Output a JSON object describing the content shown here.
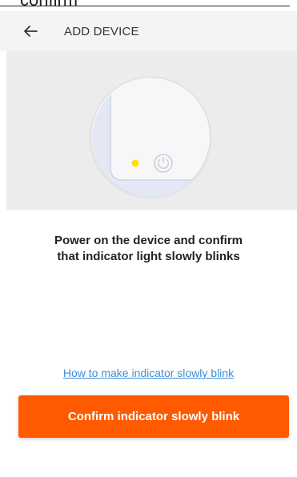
{
  "top_caption": "confirm",
  "header": {
    "title": "ADD DEVICE",
    "back_icon": "arrow-left-icon"
  },
  "illustration": {
    "indicator_color": "#ffe000",
    "icon": "power-icon"
  },
  "instruction": {
    "line1": "Power on the device and confirm",
    "line2": "that indicator light slowly blinks"
  },
  "help_link": "How to make indicator slowly blink",
  "confirm_button": "Confirm indicator slowly blink",
  "colors": {
    "accent": "#ff5a00",
    "link": "#3c8fd8"
  }
}
